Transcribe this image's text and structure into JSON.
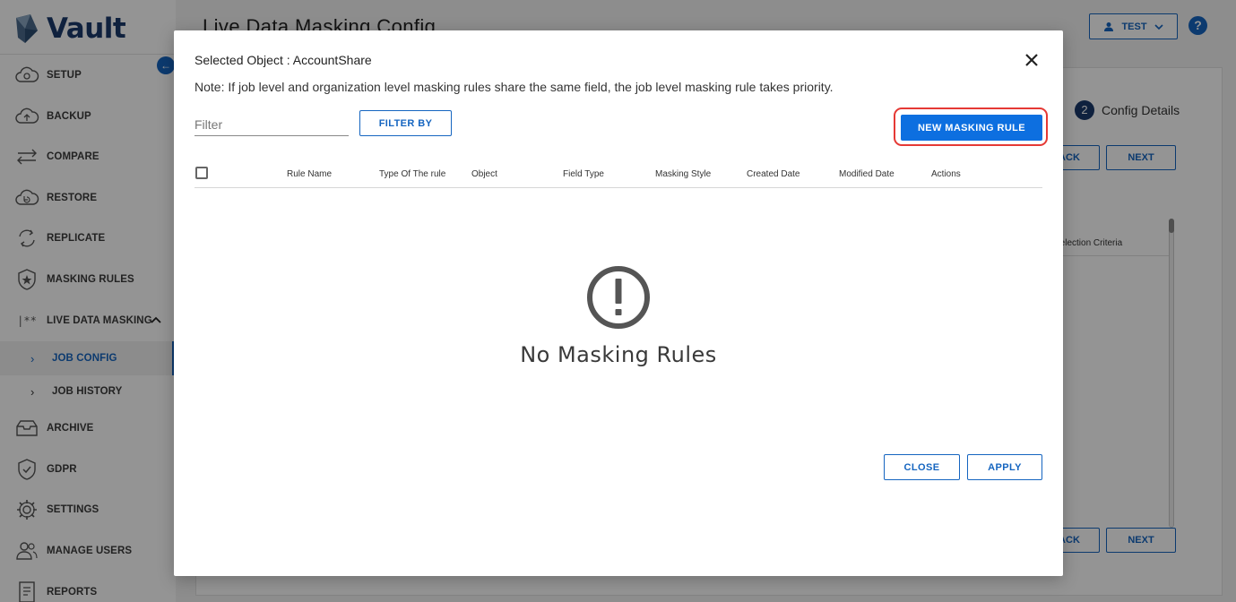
{
  "app": {
    "logo_text": "Vault"
  },
  "sidebar": {
    "items": [
      {
        "label": "SETUP",
        "icon": "cloud-gear-icon"
      },
      {
        "label": "BACKUP",
        "icon": "cloud-upload-icon"
      },
      {
        "label": "COMPARE",
        "icon": "compare-arrows-icon"
      },
      {
        "label": "RESTORE",
        "icon": "cloud-restore-icon"
      },
      {
        "label": "REPLICATE",
        "icon": "replicate-icon"
      },
      {
        "label": "MASKING RULES",
        "icon": "shield-star-icon"
      },
      {
        "label": "LIVE DATA MASKING",
        "icon": "masking-icon"
      },
      {
        "label": "ARCHIVE",
        "icon": "archive-icon"
      },
      {
        "label": "GDPR",
        "icon": "shield-check-icon"
      },
      {
        "label": "SETTINGS",
        "icon": "gear-icon"
      },
      {
        "label": "MANAGE USERS",
        "icon": "users-icon"
      },
      {
        "label": "REPORTS",
        "icon": "report-icon"
      }
    ],
    "sub_items": [
      {
        "label": "JOB CONFIG",
        "active": true
      },
      {
        "label": "JOB HISTORY",
        "active": false
      }
    ]
  },
  "header": {
    "title": "Live Data Masking Config",
    "user_label": "TEST"
  },
  "background": {
    "step_number": "2",
    "step_label": "Config Details",
    "back_label": "BACK",
    "next_label": "NEXT",
    "column_partial": "Selection Criteria"
  },
  "modal": {
    "title": "Selected Object : AccountShare",
    "note": "Note: If job level and organization level masking rules share the same field, the job level masking rule takes priority.",
    "filter_placeholder": "Filter",
    "filter_by_label": "FILTER BY",
    "new_rule_label": "NEW MASKING RULE",
    "columns": [
      "Rule Name",
      "Type Of The rule",
      "Object",
      "Field Type",
      "Masking Style",
      "Created Date",
      "Modified Date",
      "Actions"
    ],
    "empty_text": "No Masking Rules",
    "close_label": "CLOSE",
    "apply_label": "APPLY"
  },
  "colors": {
    "accent": "#1565c0",
    "brand_dark": "#1b3a6b",
    "highlight": "#e53935"
  }
}
